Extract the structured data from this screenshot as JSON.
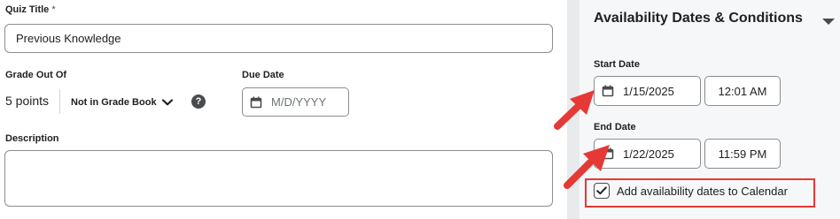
{
  "quiz_title": {
    "label": "Quiz Title",
    "required_marker": "*",
    "value": "Previous Knowledge"
  },
  "grade": {
    "label": "Grade Out Of",
    "points_text": "5 points",
    "gradebook_option": "Not in Grade Book",
    "help_glyph": "?"
  },
  "due_date": {
    "label": "Due Date",
    "placeholder": "M/D/YYYY"
  },
  "description": {
    "label": "Description",
    "value": ""
  },
  "availability": {
    "title": "Availability Dates & Conditions",
    "start": {
      "label": "Start Date",
      "date": "1/15/2025",
      "time": "12:01 AM"
    },
    "end": {
      "label": "End Date",
      "date": "1/22/2025",
      "time": "11:59 PM"
    },
    "calendar_checkbox": {
      "label": "Add availability dates to Calendar",
      "checked": true
    }
  },
  "colors": {
    "annotation_red": "#e53935",
    "panel_bg": "#f6f7f8",
    "border": "#8a8c8e"
  },
  "icons": {
    "calendar": "calendar-icon",
    "chevron": "chevron-down-icon",
    "help": "help-icon",
    "check": "checkmark-icon"
  }
}
